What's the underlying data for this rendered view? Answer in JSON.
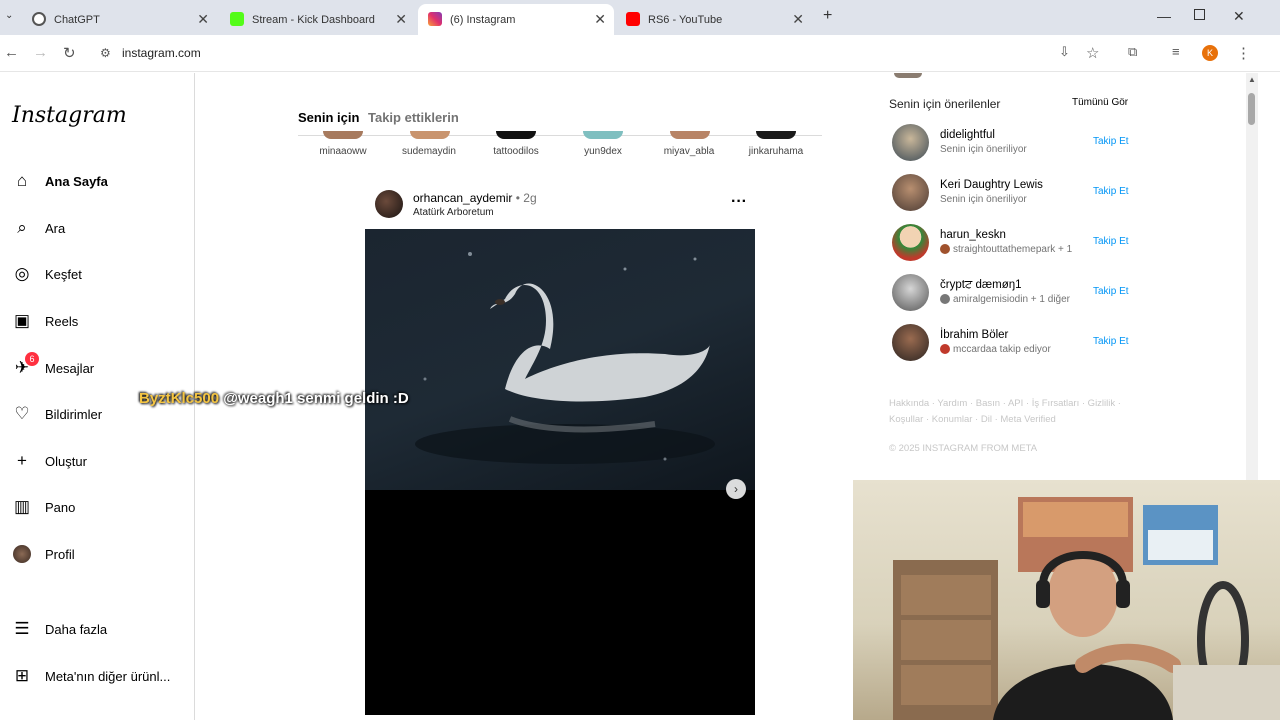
{
  "browser": {
    "tabs": [
      {
        "title": "ChatGPT",
        "favicon_color": "#444444"
      },
      {
        "title": "Stream - Kick Dashboard",
        "favicon_color": "#53fc18"
      },
      {
        "title": "(6) Instagram",
        "favicon_color": "#e1306c"
      },
      {
        "title": "RS6 - YouTube",
        "favicon_color": "#ff0000"
      }
    ],
    "new_tab": "+",
    "url": "instagram.com",
    "profile_initial": "K"
  },
  "sidebar": {
    "logo": "Instagram",
    "items": [
      {
        "label": "Ana Sayfa",
        "icon": "home-icon"
      },
      {
        "label": "Ara",
        "icon": "search-icon"
      },
      {
        "label": "Keşfet",
        "icon": "compass-icon"
      },
      {
        "label": "Reels",
        "icon": "reels-icon"
      },
      {
        "label": "Mesajlar",
        "icon": "messenger-icon",
        "badge": "6"
      },
      {
        "label": "Bildirimler",
        "icon": "heart-icon"
      },
      {
        "label": "Oluştur",
        "icon": "plus-icon"
      },
      {
        "label": "Pano",
        "icon": "dashboard-icon"
      },
      {
        "label": "Profil",
        "icon": "avatar-icon"
      }
    ],
    "more": {
      "label": "Daha fazla",
      "icon": "menu-icon"
    },
    "meta": {
      "label": "Meta'nın diğer ürünl...",
      "icon": "grid-icon"
    }
  },
  "feed": {
    "tabs": [
      "Senin için",
      "Takip ettiklerin"
    ],
    "stories": [
      "minaaoww",
      "sudemaydin",
      "tattoodilos",
      "yun9dex",
      "miyav_abla",
      "jinkaruhama"
    ],
    "post": {
      "username": "orhancan_aydemir",
      "age": "• 2g",
      "location": "Atatürk Arboretum"
    }
  },
  "chat_overlay": {
    "user": "ByztKlc500",
    "message": "@weagh1 senmi geldin :D"
  },
  "suggestions": {
    "title": "Senin için önerilenler",
    "see_all": "Tümünü Gör",
    "follow_label": "Takip Et",
    "items": [
      {
        "name": "didelightful",
        "sub": "Senin için öneriliyor"
      },
      {
        "name": "Keri Daughtry Lewis",
        "sub": "Senin için öneriliyor"
      },
      {
        "name": "harun_keskn",
        "sub": "straightouttathemepark + 1"
      },
      {
        "name": "čryptਟ dæmøŋ1",
        "sub": "amiralgemisiodin + 1 diğer"
      },
      {
        "name": "İbrahim Böler",
        "sub": "mccardaa takip ediyor"
      }
    ],
    "footer": "Hakkında · Yardım · Basın · API · İş Fırsatları · Gizlilik · Koşullar · Konumlar · Dil · Meta Verified",
    "copyright": "© 2025 INSTAGRAM FROM META"
  }
}
